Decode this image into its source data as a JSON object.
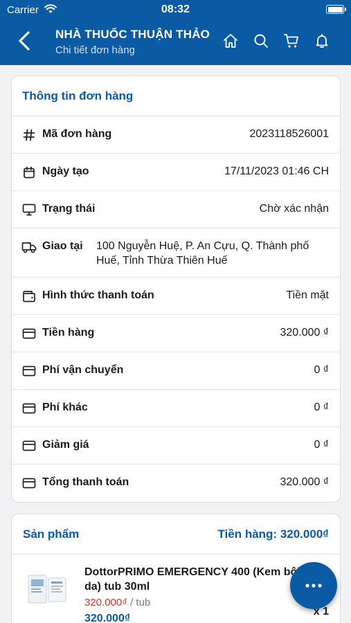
{
  "status_bar": {
    "carrier": "Carrier",
    "time": "08:32",
    "battery_level": 1.0
  },
  "header": {
    "title": "NHÀ THUỐC THUẬN THẢO",
    "subtitle": "Chi tiết đơn hàng",
    "icons": [
      "back-arrow-icon",
      "home-icon",
      "search-icon",
      "cart-icon",
      "bell-icon"
    ]
  },
  "order_info": {
    "title": "Thông tin đơn hàng",
    "rows": [
      {
        "icon": "hash-icon",
        "label": "Mã đơn hàng",
        "value": "2023118526001"
      },
      {
        "icon": "calendar-icon",
        "label": "Ngày tạo",
        "value": "17/11/2023 01:46 CH"
      },
      {
        "icon": "monitor-icon",
        "label": "Trạng thái",
        "value": "Chờ xác nhận"
      },
      {
        "icon": "truck-icon",
        "label": "Giao tại",
        "value": "100 Nguyễn Huệ, P. An Cựu, Q. Thành phố Huế, Tỉnh Thừa Thiên Huế"
      },
      {
        "icon": "wallet-icon",
        "label": "Hình thức thanh toán",
        "value": "Tiền mặt"
      },
      {
        "icon": "card-icon",
        "label": "Tiền hàng",
        "value": "320.000 ₫"
      },
      {
        "icon": "card-icon",
        "label": "Phí vận chuyển",
        "value": "0 ₫"
      },
      {
        "icon": "card-icon",
        "label": "Phí khác",
        "value": "0 ₫"
      },
      {
        "icon": "card-icon",
        "label": "Giảm giá",
        "value": "0 ₫"
      },
      {
        "icon": "card-icon",
        "label": "Tổng thanh toán",
        "value": "320.000 ₫"
      }
    ]
  },
  "products": {
    "title": "Sản phẩm",
    "subtotal": "Tiền hàng: 320.000₫",
    "items": [
      {
        "name": "DottorPRIMO EMERGENCY 400 (Kem bôi Dịu da) tub 30ml",
        "price": "320.000₫",
        "unit": " / tub",
        "total": "320.000₫",
        "qty": "x 1"
      }
    ]
  },
  "fab": {
    "icon": "more-dots-icon"
  },
  "colors": {
    "primary": "#0a5aa4",
    "price": "#d9352b"
  }
}
